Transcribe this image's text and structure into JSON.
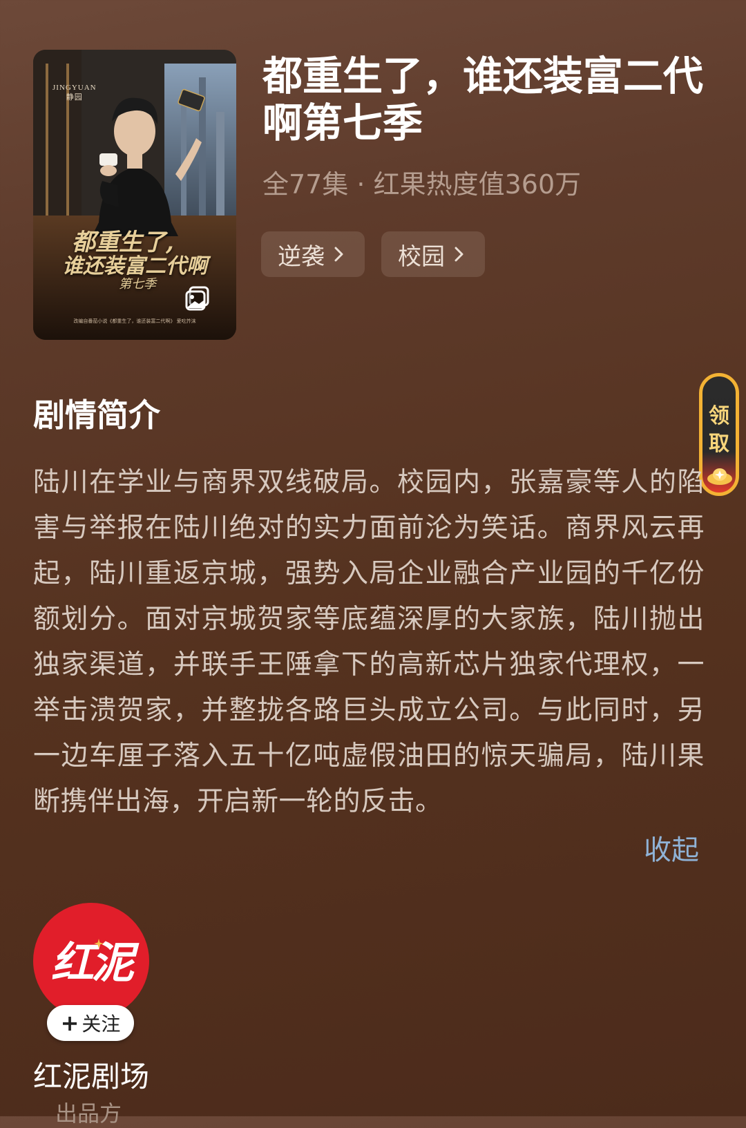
{
  "drama": {
    "title": "都重生了，谁还装富二代啊第七季",
    "meta": "全77集 · 红果热度值360万",
    "tags": [
      {
        "label": "逆袭"
      },
      {
        "label": "校园"
      }
    ]
  },
  "poster": {
    "brand_top": "JINGYUAN",
    "brand_sub": "静园",
    "title_line1": "都重生了,",
    "title_line2": "谁还装富二代啊",
    "title_line3": "第七季",
    "fine_print": "改编自番茄小说《都重生了，谁还装富二代啊》 爱吃芥沫",
    "gallery_icon": "gallery-icon"
  },
  "synopsis": {
    "heading": "剧情简介",
    "text": "陆川在学业与商界双线破局。校园内，张嘉豪等人的陷害与举报在陆川绝对的实力面前沦为笑话。商界风云再起，陆川重返京城，强势入局企业融合产业园的千亿份额划分。面对京城贺家等底蕴深厚的大家族，陆川抛出独家渠道，并联手王陲拿下的高新芯片独家代理权，一举击溃贺家，并整拢各路巨头成立公司。与此同时，另一边车厘子落入五十亿吨虚假油田的惊天骗局，陆川果断携伴出海，开启新一轮的反击。",
    "collapse_label": "收起"
  },
  "claim_widget": {
    "line1": "领",
    "line2": "取"
  },
  "producer": {
    "logo_text": "红泥",
    "follow_label": "关注",
    "name": "红泥剧场",
    "role": "出品方"
  },
  "colors": {
    "background_top": "#6d4939",
    "background_bottom": "#4c2b1b",
    "link": "#8fb2d6",
    "brand_red": "#e11e2a",
    "claim_gold": "#f3b234"
  }
}
